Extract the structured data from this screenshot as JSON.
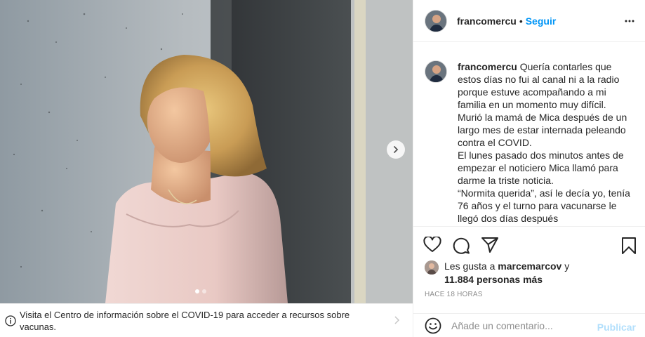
{
  "post": {
    "username": "francomercu",
    "follow_label": "Seguir",
    "separator": "•",
    "caption_lines": [
      "Quería contarles que estos días no fui al canal ni a la radio porque estuve acompañando a mi familia en un momento muy difícil.",
      "Murió la mamá de Mica después de un largo mes de estar internada peleando contra el COVID.",
      "El lunes pasado dos minutos antes de empezar el noticiero Mica llamó para darme la triste noticia.",
      "“Normita querida”, así le decía yo, tenía 76 años y el turno para vacunarse le llegó dos días después"
    ],
    "likes_prefix": "Les gusta a",
    "likes_user": "marcemarcov",
    "likes_and": "y",
    "likes_count": "11.884 personas más",
    "timestamp": "HACE 18 HORAS",
    "comment_placeholder": "Añade un comentario...",
    "publish_label": "Publicar"
  },
  "carousel": {
    "current_slide": 1,
    "total_slides": 2
  },
  "covid_banner": {
    "text": "Visita el Centro de información sobre el COVID-19 para acceder a recursos sobre vacunas."
  },
  "icons": {
    "heart": "heart-icon",
    "comment": "comment-icon",
    "share": "share-icon",
    "save": "bookmark-icon",
    "more": "more-options-icon",
    "emoji": "emoji-icon",
    "info": "info-icon",
    "next": "chevron-right-icon"
  },
  "colors": {
    "follow": "#0095f6",
    "publish_disabled": "#b2dffc",
    "muted": "#8e8e8e"
  }
}
